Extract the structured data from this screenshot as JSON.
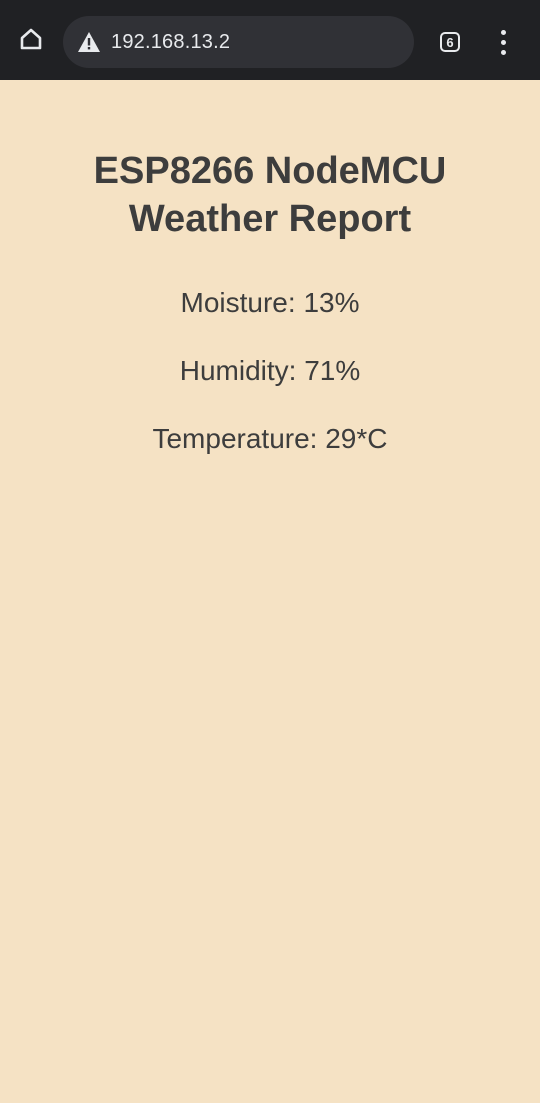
{
  "browser": {
    "url": "192.168.13.2",
    "tab_count": "6",
    "icons": {
      "home": "home-icon",
      "security": "warning-triangle-icon",
      "tabs": "tab-switcher-icon",
      "menu": "more-vertical-icon"
    },
    "colors": {
      "toolbar": "#202124",
      "omnibox": "#303136",
      "text": "#e8eaed"
    }
  },
  "page": {
    "title": "ESP8266 NodeMCU Weather Report",
    "readings": [
      {
        "label": "Moisture: 13%"
      },
      {
        "label": "Humidity: 71%"
      },
      {
        "label": "Temperature: 29*C"
      }
    ],
    "colors": {
      "background": "#f5e2c4",
      "text": "#3d3d3d"
    }
  }
}
